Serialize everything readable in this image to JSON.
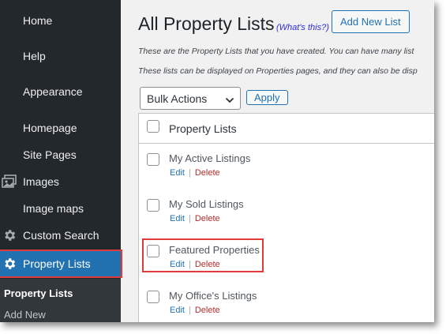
{
  "sidebar": {
    "items": [
      {
        "label": "Home",
        "icon": ""
      },
      {
        "label": "Help",
        "icon": ""
      },
      {
        "label": "Appearance",
        "icon": ""
      },
      {
        "label": "Homepage",
        "icon": ""
      },
      {
        "label": "Site Pages",
        "icon": ""
      },
      {
        "label": "Images",
        "icon": "images-icon"
      },
      {
        "label": "Image maps",
        "icon": ""
      },
      {
        "label": "Custom Search",
        "icon": "gear-icon"
      },
      {
        "label": "Property Lists",
        "icon": "gear-icon",
        "active": true
      }
    ],
    "submenu": [
      {
        "label": "Property Lists",
        "current": true
      },
      {
        "label": "Add New"
      }
    ]
  },
  "header": {
    "title": "All Property Lists",
    "whats_this": "(What's this?)",
    "add_new_label": "Add New List"
  },
  "intro": [
    "These are the Property Lists that you have created. You can have many list",
    "These lists can be displayed on Properties pages, and they can also be disp"
  ],
  "toolbar": {
    "bulk_actions_value": "Bulk Actions",
    "apply_label": "Apply"
  },
  "table": {
    "column_header": "Property Lists",
    "rows": [
      {
        "title": "My Active Listings",
        "edit": "Edit",
        "delete": "Delete"
      },
      {
        "title": "My Sold Listings",
        "edit": "Edit",
        "delete": "Delete"
      },
      {
        "title": "Featured Properties",
        "edit": "Edit",
        "delete": "Delete",
        "highlighted": true
      },
      {
        "title": "My Office's Listings",
        "edit": "Edit",
        "delete": "Delete"
      }
    ]
  },
  "colors": {
    "sidebar_bg": "#23282d",
    "active_bg": "#2271b1",
    "highlight": "#e03b3b",
    "link": "#2271b1",
    "delete": "#b32d2e"
  }
}
